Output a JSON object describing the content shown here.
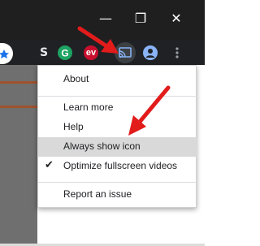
{
  "window": {
    "minimize_glyph": "—",
    "restore_glyph": "❐",
    "close_glyph": "✕"
  },
  "toolbar": {
    "extensions": [
      {
        "name": "s-extension-icon",
        "glyph": "S"
      },
      {
        "name": "grammarly-icon",
        "glyph": "G"
      },
      {
        "name": "expressvpn-icon",
        "glyph": "ev"
      }
    ],
    "cast_icon": "cast-icon",
    "profile_icon": "profile-icon",
    "menu_icon": "kebab-menu-icon"
  },
  "menu": {
    "items": [
      {
        "label": "About"
      },
      {
        "label": "Learn more"
      },
      {
        "label": "Help"
      },
      {
        "label": "Always show icon",
        "highlighted": true
      },
      {
        "label": "Optimize fullscreen videos",
        "checked": true
      },
      {
        "label": "Report an issue"
      }
    ],
    "check_glyph": "✔"
  },
  "colors": {
    "window_bar": "#1f1f20",
    "toolbar": "#202124",
    "arrow": "#e21b1b",
    "highlight": "#d9d9d9",
    "page_stripe": "#a0522d"
  }
}
